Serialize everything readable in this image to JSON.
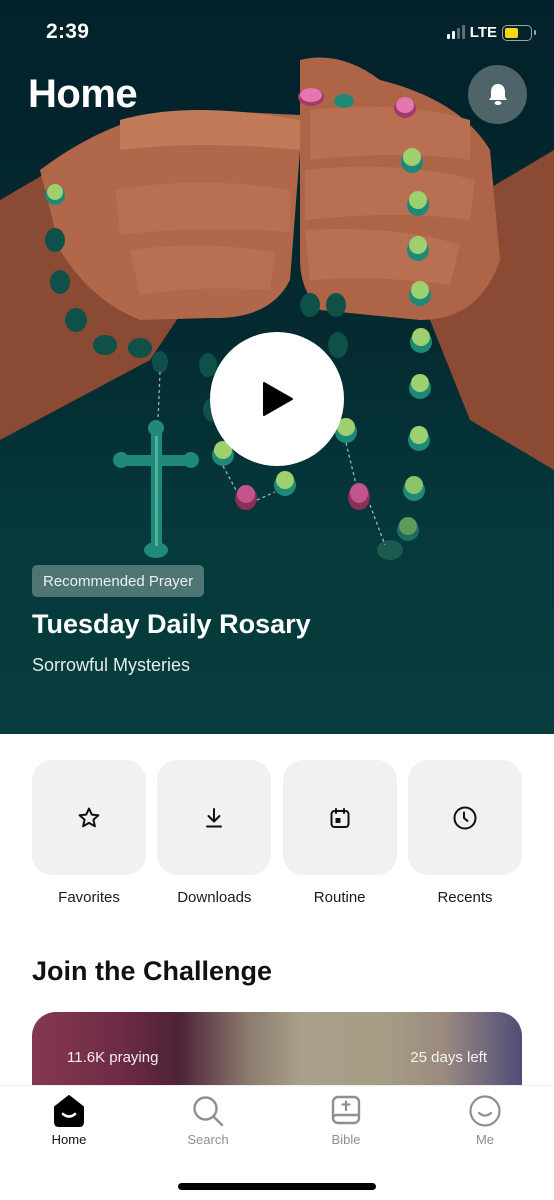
{
  "status_bar": {
    "time": "2:39",
    "network": "LTE",
    "signal_bars_active": 2,
    "signal_bars_total": 4,
    "battery_level": 0.55,
    "battery_color": "#ffd60a"
  },
  "header": {
    "title": "Home",
    "bell_icon": "bell-icon"
  },
  "hero": {
    "badge": "Recommended Prayer",
    "title": "Tuesday Daily Rosary",
    "subtitle": "Sorrowful Mysteries",
    "play_icon": "play-icon",
    "background_color": "#042a30"
  },
  "quick_actions": [
    {
      "label": "Favorites",
      "icon": "star-icon"
    },
    {
      "label": "Downloads",
      "icon": "download-icon"
    },
    {
      "label": "Routine",
      "icon": "calendar-icon"
    },
    {
      "label": "Recents",
      "icon": "clock-icon"
    }
  ],
  "challenge": {
    "section_title": "Join the Challenge",
    "praying_count": "11.6K praying",
    "days_left": "25 days left"
  },
  "tab_bar": {
    "active": "Home",
    "tabs": [
      {
        "label": "Home",
        "icon": "home-icon"
      },
      {
        "label": "Search",
        "icon": "search-icon"
      },
      {
        "label": "Bible",
        "icon": "bible-icon"
      },
      {
        "label": "Me",
        "icon": "profile-icon"
      }
    ]
  }
}
